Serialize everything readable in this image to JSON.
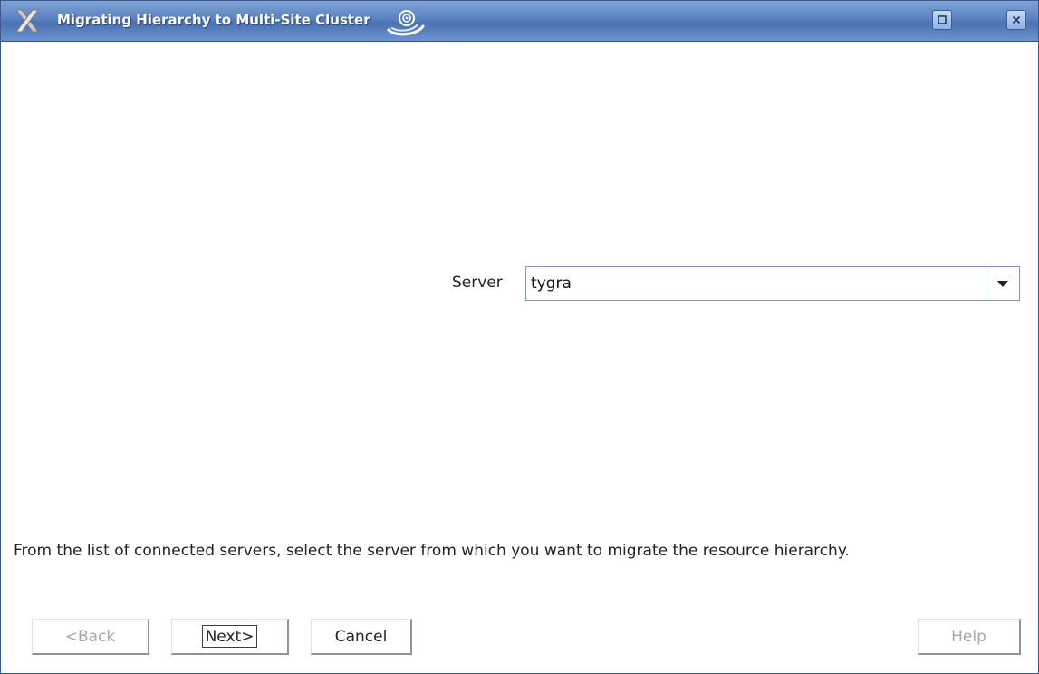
{
  "window": {
    "title": "Migrating Hierarchy to Multi-Site Cluster",
    "icons": {
      "app": "x-app-icon",
      "swirl": "swirl-icon",
      "maximize": "maximize-icon",
      "close": "close-icon"
    }
  },
  "form": {
    "server_label": "Server",
    "server_value": "tygra",
    "dropdown_icon": "chevron-down-icon"
  },
  "instruction": "From the list of connected servers, select the server from which you want to migrate the resource hierarchy.",
  "buttons": {
    "back": "<Back",
    "next": "Next>",
    "cancel": "Cancel",
    "help": "Help"
  },
  "colors": {
    "titlebar": "#5b82c1",
    "title_text": "#ffffff",
    "disabled_text": "#a7a7a7"
  }
}
